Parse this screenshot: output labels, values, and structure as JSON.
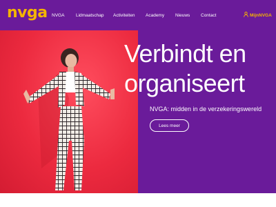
{
  "header": {
    "logo": "nvga",
    "nav": [
      "NVGA",
      "Lidmaatschap",
      "Activiteiten",
      "Academy",
      "Nieuws",
      "Contact"
    ],
    "account_link": "MijnNVGA"
  },
  "hero": {
    "title_line1": "Verbindt en",
    "title_line2": "organiseert",
    "subtitle": "NVGA: midden in de verzekeringswereld",
    "button": "Lees meer"
  },
  "colors": {
    "brand_purple": "#6a1b9a",
    "accent_yellow": "#f4b400",
    "photo_red": "#ec2a3f"
  },
  "icons": {
    "account": "user-icon"
  }
}
